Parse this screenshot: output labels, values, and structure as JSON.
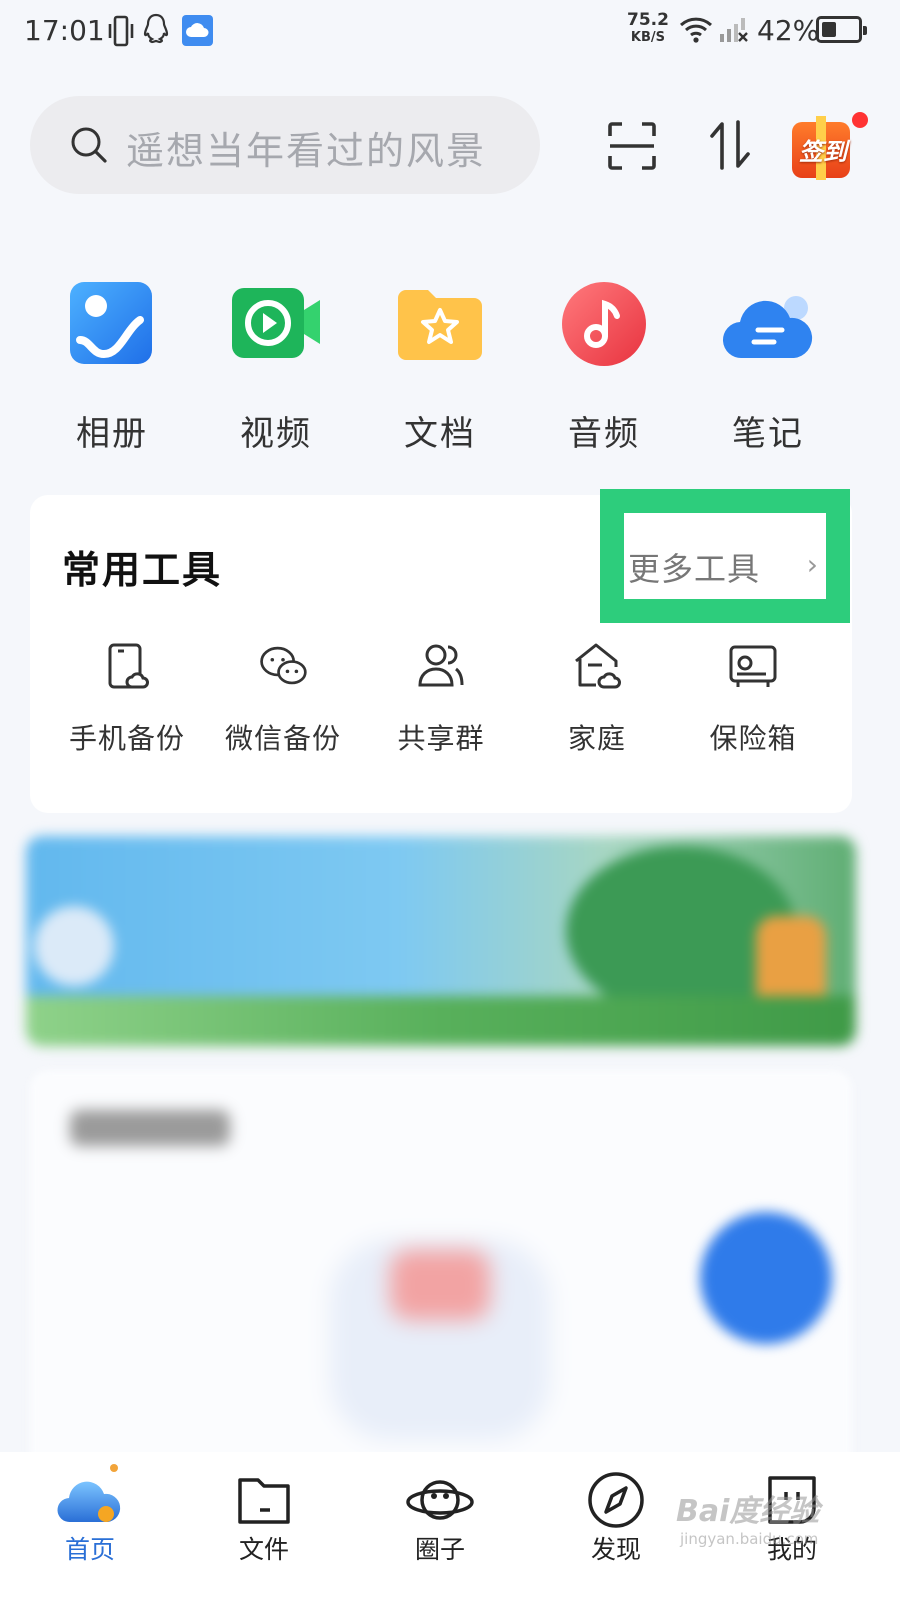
{
  "status_bar": {
    "time": "17:01",
    "net_speed": "75.2",
    "net_unit": "KB/S",
    "battery_text": "42%",
    "battery_level": 0.42
  },
  "search": {
    "placeholder": "遥想当年看过的风景"
  },
  "header": {
    "signin_label": "签到"
  },
  "categories": [
    {
      "label": "相册",
      "icon": "album-icon"
    },
    {
      "label": "视频",
      "icon": "video-icon"
    },
    {
      "label": "文档",
      "icon": "document-icon"
    },
    {
      "label": "音频",
      "icon": "audio-icon"
    },
    {
      "label": "笔记",
      "icon": "note-icon"
    }
  ],
  "tools": {
    "title": "常用工具",
    "more_label": "更多工具",
    "items": [
      {
        "label": "手机备份",
        "icon": "phone-backup-icon"
      },
      {
        "label": "微信备份",
        "icon": "wechat-backup-icon"
      },
      {
        "label": "共享群",
        "icon": "share-group-icon"
      },
      {
        "label": "家庭",
        "icon": "family-icon"
      },
      {
        "label": "保险箱",
        "icon": "safe-icon"
      }
    ]
  },
  "bottom_nav": [
    {
      "label": "首页",
      "icon": "home-cloud-icon",
      "active": true
    },
    {
      "label": "文件",
      "icon": "folder-icon",
      "active": false
    },
    {
      "label": "圈子",
      "icon": "planet-icon",
      "active": false
    },
    {
      "label": "发现",
      "icon": "compass-icon",
      "active": false
    },
    {
      "label": "我的",
      "icon": "profile-icon",
      "active": false
    }
  ],
  "watermark": {
    "logo": "Bai度经验",
    "url": "jingyan.baidu.com"
  },
  "colors": {
    "highlight": "#2dcd7c",
    "active_nav": "#2a6fd6",
    "page_bg": "#f5f7fb"
  }
}
